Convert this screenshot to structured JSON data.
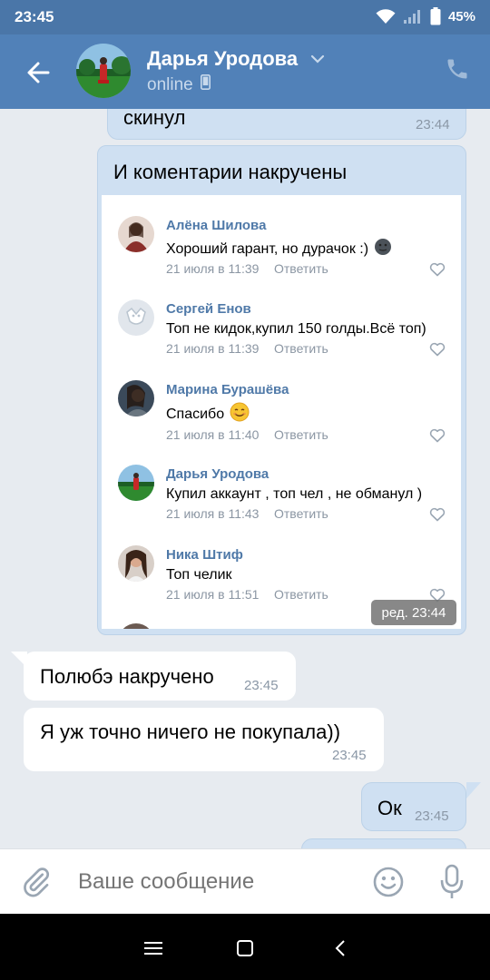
{
  "status_bar": {
    "time": "23:45",
    "battery": "45%"
  },
  "header": {
    "name": "Дарья Уродова",
    "status": "online"
  },
  "messages": {
    "m1_text": "скинул",
    "m1_time": "23:44",
    "m2_caption": "И коментарии накручены",
    "m2_edited": "ред. 23:44",
    "m3_text": "Полюбэ накручено",
    "m3_time": "23:45",
    "m4_text": "Я уж точно ничего не покупала))",
    "m4_time": "23:45",
    "m5_text": "Ок",
    "m5_time": "23:45"
  },
  "comments": [
    {
      "name": "Алёна Шилова",
      "text": "Хороший гарант, но дурачок :)",
      "date": "21 июля в 11:39",
      "reply": "Ответить"
    },
    {
      "name": "Сергей Енов",
      "text": "Топ не кидок,купил 150 голды.Всё топ)",
      "date": "21 июля в 11:39",
      "reply": "Ответить"
    },
    {
      "name": "Марина Бурашёва",
      "text": "Спасибо",
      "date": "21 июля в 11:40",
      "reply": "Ответить"
    },
    {
      "name": "Дарья Уродова",
      "text": "Купил аккаунт , топ чел , не обманул )",
      "date": "21 июля в 11:43",
      "reply": "Ответить"
    },
    {
      "name": "Ника Штиф",
      "text": "Топ челик",
      "date": "21 июля в 11:51",
      "reply": "Ответить"
    }
  ],
  "composer": {
    "placeholder": "Ваше сообщение"
  },
  "colors": {
    "header": "#5181b8",
    "status_bar": "#4a76a8",
    "background": "#e7ebf0",
    "outgoing_bubble": "#cfe0f2",
    "link": "#4f79a8"
  },
  "icons": [
    "back-arrow-icon",
    "chevron-down-icon",
    "phone-icon",
    "mobile-icon",
    "attach-icon",
    "emoji-icon",
    "mic-icon",
    "heart-icon",
    "wifi-icon",
    "signal-icon",
    "battery-icon"
  ]
}
